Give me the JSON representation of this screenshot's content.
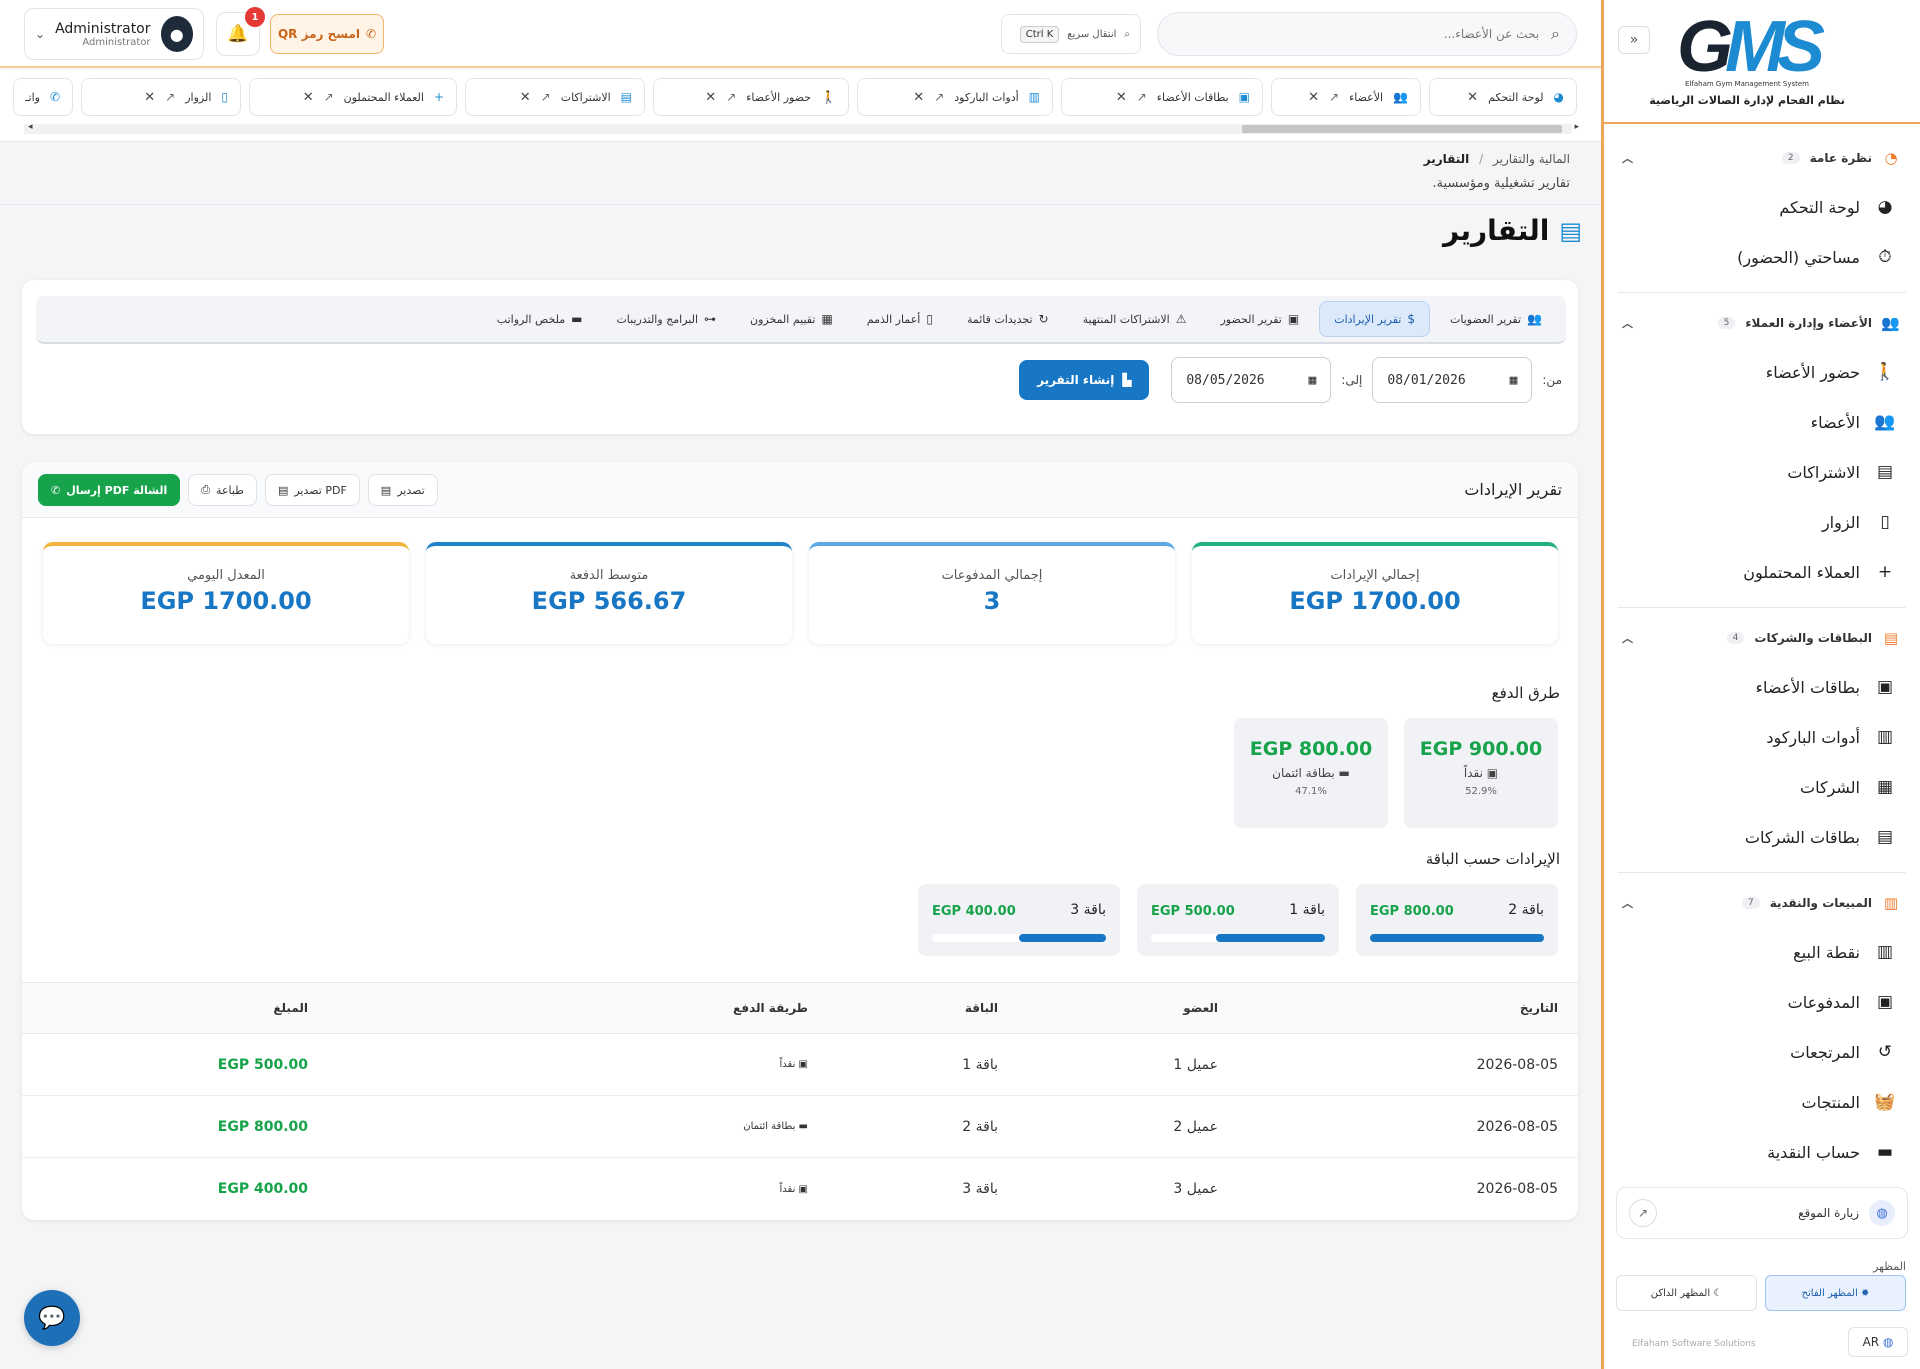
{
  "sidebar": {
    "logo_text_g": "G",
    "logo_text_ms": "MS",
    "logo_subtitle": "Elfaham Gym Management System",
    "logo_tagline": "نظام الفحام لإدارة الصالات الرياضية",
    "groups": [
      {
        "label": "نظرة عامة",
        "count": "2",
        "icon": "gauge-icon",
        "items": [
          {
            "label": "لوحة التحكم",
            "icon": "dashboard-icon"
          },
          {
            "label": "مساحتي (الحضور)",
            "icon": "stopwatch-icon"
          }
        ]
      },
      {
        "label": "الأعضاء وإدارة العملاء",
        "count": "5",
        "icon": "users-icon",
        "items": [
          {
            "label": "حضور الأعضاء",
            "icon": "walking-icon"
          },
          {
            "label": "الأعضاء",
            "icon": "users-icon"
          },
          {
            "label": "الاشتراكات",
            "icon": "id-card-icon"
          },
          {
            "label": "الزوار",
            "icon": "door-icon"
          },
          {
            "label": "العملاء المحتملون",
            "icon": "user-plus-icon"
          }
        ]
      },
      {
        "label": "البطاقات والشركات",
        "count": "4",
        "icon": "id-card-icon",
        "items": [
          {
            "label": "بطاقات الأعضاء",
            "icon": "id-badge-icon"
          },
          {
            "label": "أدوات الباركود",
            "icon": "barcode-icon"
          },
          {
            "label": "الشركات",
            "icon": "building-icon"
          },
          {
            "label": "بطاقات الشركات",
            "icon": "address-card-icon"
          }
        ]
      },
      {
        "label": "المبيعات والنقدية",
        "count": "7",
        "icon": "cash-register-icon",
        "items": [
          {
            "label": "نقطة البيع",
            "icon": "cash-register-icon"
          },
          {
            "label": "المدفوعات",
            "icon": "money-icon"
          },
          {
            "label": "المرتجعات",
            "icon": "undo-icon"
          },
          {
            "label": "المنتجات",
            "icon": "basket-icon"
          },
          {
            "label": "حساب النقدية",
            "icon": "wallet-icon"
          }
        ]
      }
    ],
    "visit_site": "زيارة الموقع",
    "theme_label": "المظهر",
    "theme_dark": "المظهر الداكن",
    "theme_light": "المظهر الفاتح",
    "lang": "AR",
    "company": "Elfaham Software Solutions"
  },
  "topbar": {
    "search_placeholder": "بحث عن الأعضاء...",
    "quick_nav": "انتقال سريع",
    "quick_kbd": "Ctrl K",
    "user_name": "Administrator",
    "user_role": "Administrator",
    "notif_count": "1",
    "qr_label": "امسح رمز QR"
  },
  "tabs": [
    {
      "label": "لوحة التحكم",
      "icon": "dashboard-icon"
    },
    {
      "label": "الأعضاء",
      "icon": "users-icon"
    },
    {
      "label": "بطاقات الأعضاء",
      "icon": "id-badge-icon"
    },
    {
      "label": "أدوات الباركود",
      "icon": "barcode-icon"
    },
    {
      "label": "حضور الأعضاء",
      "icon": "walking-icon"
    },
    {
      "label": "الاشتراكات",
      "icon": "id-card-icon"
    },
    {
      "label": "العملاء المحتملون",
      "icon": "user-plus-icon"
    },
    {
      "label": "الزوار",
      "icon": "door-icon"
    },
    {
      "label": "واتـ",
      "icon": "whatsapp-icon"
    }
  ],
  "breadcrumb": {
    "parent": "المالية والتقارير",
    "sep": "/",
    "current": "التقارير",
    "desc": "تقارير تشغيلية ومؤسسية."
  },
  "page_title": "التقارير",
  "report_tabs": [
    {
      "label": "تقرير العضويات",
      "icon": "users-icon",
      "active": false
    },
    {
      "label": "تقرير الإيرادات",
      "icon": "dollar-icon",
      "active": true
    },
    {
      "label": "تقرير الحضور",
      "icon": "calendar-check-icon",
      "active": false
    },
    {
      "label": "الاشتراكات المنتهية",
      "icon": "warning-icon",
      "active": false
    },
    {
      "label": "تجديدات قائمة",
      "icon": "refresh-icon",
      "active": false
    },
    {
      "label": "أعمار الذمم",
      "icon": "file-invoice-icon",
      "active": false
    },
    {
      "label": "تقييم المخزون",
      "icon": "boxes-icon",
      "active": false
    },
    {
      "label": "البرامج والتدريبات",
      "icon": "dumbbell-icon",
      "active": false
    },
    {
      "label": "ملخص الرواتب",
      "icon": "money-check-icon",
      "active": false
    }
  ],
  "filters": {
    "from_label": "من:",
    "from_value": "08/01/2026",
    "to_label": "إلى:",
    "to_value": "08/05/2026",
    "generate": "إنشاء التقرير"
  },
  "report": {
    "title": "تقرير الإيرادات",
    "actions": {
      "export": "تصدير",
      "export_pdf": "تصدير PDF",
      "print": "طباعة",
      "send_pdf": "إرسال PDF الشالة"
    },
    "stats": [
      {
        "label": "إجمالي الإيرادات",
        "value": "EGP 1700.00",
        "color": "#22b07d"
      },
      {
        "label": "إجمالي المدفوعات",
        "value": "3",
        "color": "#5aa9e6"
      },
      {
        "label": "متوسط الدفعة",
        "value": "EGP 566.67",
        "color": "#1f84c9"
      },
      {
        "label": "المعدل اليومي",
        "value": "EGP 1700.00",
        "color": "#f2b53c"
      }
    ],
    "payment_methods_title": "طرق الدفع",
    "payment_methods": [
      {
        "amount": "EGP 900.00",
        "name": "نقداً",
        "pct": "52.9%",
        "icon": "cash-icon"
      },
      {
        "amount": "EGP 800.00",
        "name": "بطاقة ائتمان",
        "pct": "47.1%",
        "icon": "credit-card-icon"
      }
    ],
    "by_plan_title": "الإيرادات حسب الباقة",
    "by_plan": [
      {
        "name": "باقة 2",
        "amount": "EGP 800.00",
        "share": 1.0
      },
      {
        "name": "باقة 1",
        "amount": "EGP 500.00",
        "share": 0.625
      },
      {
        "name": "باقة 3",
        "amount": "EGP 400.00",
        "share": 0.5
      }
    ],
    "table": {
      "headers": {
        "date": "التاريخ",
        "member": "العضو",
        "plan": "الباقة",
        "method": "طريقة الدفع",
        "amount": "المبلغ"
      },
      "rows": [
        {
          "date": "2026-08-05",
          "member": "عميل 1",
          "plan": "باقة 1",
          "method": "نقداً",
          "amount": "EGP 500.00"
        },
        {
          "date": "2026-08-05",
          "member": "عميل 2",
          "plan": "باقة 2",
          "method": "بطاقة ائتمان",
          "amount": "EGP 800.00"
        },
        {
          "date": "2026-08-05",
          "member": "عميل 3",
          "plan": "باقة 3",
          "method": "نقداً",
          "amount": "EGP 400.00"
        }
      ]
    }
  }
}
